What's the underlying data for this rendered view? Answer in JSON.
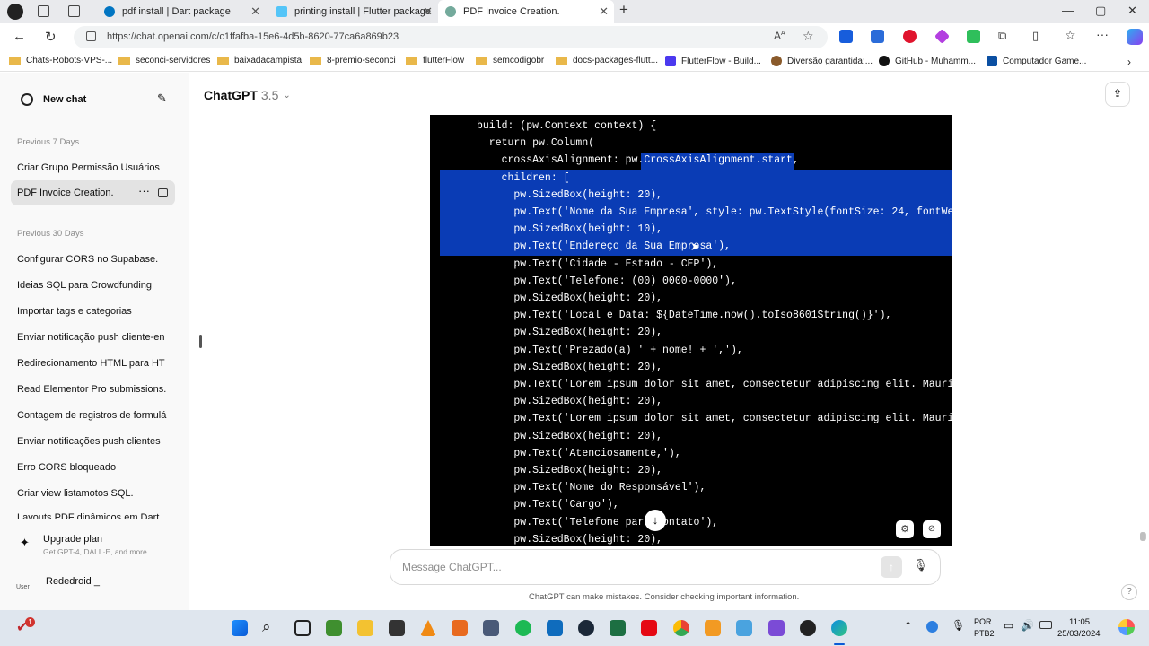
{
  "browser": {
    "tabs": [
      {
        "title": "pdf install | Dart package"
      },
      {
        "title": "printing install | Flutter package"
      },
      {
        "title": "PDF Invoice Creation."
      }
    ],
    "url": "https://chat.openai.com/c/c1ffafba-15e6-4d5b-8620-77ca6a869b23",
    "bookmarks": [
      "Chats-Robots-VPS-...",
      "seconci-servidores",
      "baixadacampista",
      "8-premio-seconci",
      "flutterFlow",
      "semcodigobr",
      "docs-packages-flutt...",
      "FlutterFlow - Build...",
      "Diversão garantida:...",
      "GitHub - Muhamm...",
      "Computador Game..."
    ]
  },
  "sidebar": {
    "new_chat": "New chat",
    "section1": "Previous 7 Days",
    "recent": [
      "Criar Grupo Permissão Usuários",
      "PDF Invoice Creation."
    ],
    "section2": "Previous 30 Days",
    "older": [
      "Configurar CORS no Supabase.",
      "Ideias SQL para Crowdfunding",
      "Importar tags e categorias",
      "Enviar notificação push cliente-en",
      "Redirecionamento HTML para HT",
      "Read Elementor Pro submissions.",
      "Contagem de registros de formulá",
      "Enviar notificações push clientes",
      "Erro CORS bloqueado",
      "Criar view listamotos SQL.",
      "Layouts PDF dinâmicos em Dart"
    ],
    "upgrade_title": "Upgrade plan",
    "upgrade_sub": "Get GPT-4, DALL·E, and more",
    "user": "Rededroid _",
    "avatar_text": "User"
  },
  "main": {
    "model": "ChatGPT",
    "version": "3.5",
    "code_lines": [
      "build: (pw.Context context) {",
      "  return pw.Column(",
      "    crossAxisAlignment: pw.CrossAxisAlignment.start,",
      "    children: [",
      "      pw.SizedBox(height: 20),",
      "      pw.Text('Nome da Sua Empresa', style: pw.TextStyle(fontSize: 24, fontWeig",
      "      pw.SizedBox(height: 10),",
      "      pw.Text('Endereço da Sua Empresa'),",
      "      pw.Text('Cidade - Estado - CEP'),",
      "      pw.Text('Telefone: (00) 0000-0000'),",
      "      pw.SizedBox(height: 20),",
      "      pw.Text('Local e Data: ${DateTime.now().toIso8601String()}'),",
      "      pw.SizedBox(height: 20),",
      "      pw.Text('Prezado(a) ' + nome! + ','),",
      "      pw.SizedBox(height: 20),",
      "      pw.Text('Lorem ipsum dolor sit amet, consectetur adipiscing elit. Mauris",
      "      pw.SizedBox(height: 20),",
      "      pw.Text('Lorem ipsum dolor sit amet, consectetur adipiscing elit. Mauris",
      "      pw.SizedBox(height: 20),",
      "      pw.Text('Atenciosamente,'),",
      "      pw.SizedBox(height: 20),",
      "      pw.Text('Nome do Responsável'),",
      "      pw.Text('Cargo'),",
      "      pw.Text('Telefone para contato'),",
      "      pw.SizedBox(height: 20),"
    ],
    "placeholder": "Message ChatGPT...",
    "disclaimer": "ChatGPT can make mistakes. Consider checking important information.",
    "help": "?"
  },
  "taskbar": {
    "lang": "POR",
    "layout": "PTB2",
    "time": "11:05",
    "date": "25/03/2024",
    "badge": "1"
  },
  "colors": {
    "selection": "#0a3cb5",
    "code_bg": "#000000",
    "sidebar_bg": "#f9f9f9"
  }
}
